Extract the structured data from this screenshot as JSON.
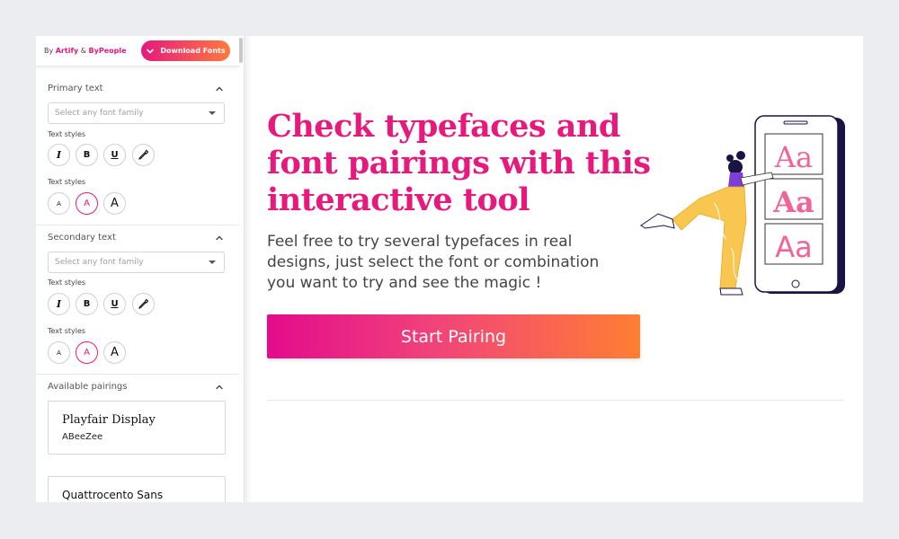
{
  "sidebar": {
    "credit": {
      "by": "By",
      "brand1": "Artify",
      "amp": "&",
      "brand2": "ByPeople"
    },
    "download_label": "Download Fonts",
    "primary": {
      "title": "Primary text",
      "placeholder": "Select any font family",
      "styles_label": "Text styles",
      "sizes_label": "Text styles",
      "style_icons": [
        "I",
        "B",
        "U"
      ],
      "size_icons": [
        "A",
        "A",
        "A"
      ]
    },
    "secondary": {
      "title": "Secondary text",
      "placeholder": "Select any font family",
      "styles_label": "Text styles",
      "sizes_label": "Text styles",
      "style_icons": [
        "I",
        "B",
        "U"
      ],
      "size_icons": [
        "A",
        "A",
        "A"
      ]
    },
    "pairings": {
      "title": "Available pairings",
      "items": [
        {
          "heading": "Playfair Display",
          "body": "ABeeZee"
        },
        {
          "heading": "Quattrocento Sans",
          "body": ""
        }
      ]
    }
  },
  "main": {
    "headline": [
      "Check typefaces and",
      "font pairings with this",
      "interactive tool"
    ],
    "subtext": [
      "Feel free to try several typefaces in real",
      "designs, just select the font or combination",
      "you want to try and see the magic !"
    ],
    "cta_label": "Start Pairing",
    "illustration_letters": [
      "Aa",
      "Aa",
      "Aa"
    ]
  },
  "colors": {
    "accent": "#e6197d",
    "gradient_end": "#ff7a3d",
    "dark": "#1a1446",
    "yellow": "#f9c74f"
  }
}
